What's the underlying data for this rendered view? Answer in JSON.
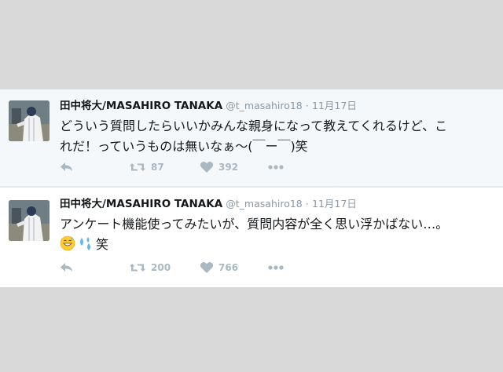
{
  "tweets": [
    {
      "name": "田中将大/MASAHIRO TANAKA",
      "handle": "@t_masahiro18",
      "separator": "·",
      "date": "11月17日",
      "text_line1": "どういう質問したらいいかみんな親身になって教えてくれるけど、こ",
      "text_line2": "れだ！っていうものは無いなぁ〜(￣ー￣)笑",
      "retweets": "87",
      "likes": "392"
    },
    {
      "name": "田中将大/MASAHIRO TANAKA",
      "handle": "@t_masahiro18",
      "separator": "·",
      "date": "11月17日",
      "text_line1": "アンケート機能使ってみたいが、質問内容が全く思い浮かばない…。",
      "text_line2": "笑",
      "retweets": "200",
      "likes": "766"
    }
  ],
  "icons": {
    "reply": "reply-icon",
    "retweet": "retweet-icon",
    "like": "heart-icon",
    "more": "more-icon",
    "emoji1": "grinning-sweat-emoji",
    "emoji2": "sweat-droplets-emoji"
  },
  "colors": {
    "action_gray": "#aab8c2",
    "meta_gray": "#8899a6",
    "text": "#14171a"
  }
}
